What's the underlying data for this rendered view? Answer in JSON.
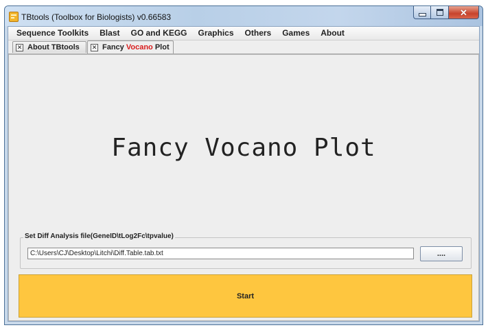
{
  "window": {
    "title": "TBtools (Toolbox for Biologists) v0.66583"
  },
  "menu": {
    "items": [
      "Sequence Toolkits",
      "Blast",
      "GO and KEGG",
      "Graphics",
      "Others",
      "Games",
      "About"
    ]
  },
  "tabs": [
    {
      "label": "About TBtools"
    },
    {
      "label_prefix": "Fancy ",
      "label_highlight": "Vocano",
      "label_suffix": " Plot"
    }
  ],
  "panel": {
    "title": "Fancy Vocano Plot",
    "group_label": "Set Diff Analysis file(GeneID\\tLog2Fc\\tpvalue)",
    "file_path": "C:\\Users\\CJ\\Desktop\\Litchi\\Diff.Table.tab.txt",
    "browse_label": "....",
    "start_label": "Start"
  },
  "colors": {
    "start_button": "#fec63f",
    "tab_highlight": "#d81c1c"
  },
  "icons": {
    "app": "tbtools-app-icon",
    "tab_close": "tab-close-icon"
  }
}
